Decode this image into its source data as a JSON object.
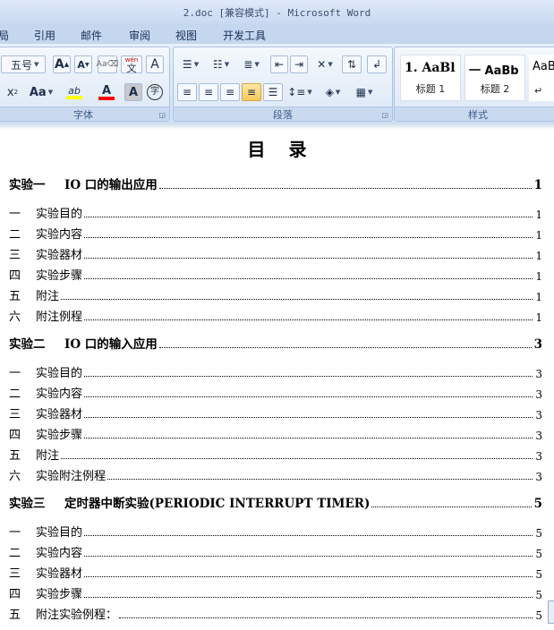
{
  "window": {
    "title": "2.doc [兼容模式] - Microsoft Word"
  },
  "tabs": [
    "局",
    "引用",
    "邮件",
    "审阅",
    "视图",
    "开发工具"
  ],
  "ribbon": {
    "font_size": "五号",
    "grow_font": "A",
    "shrink_font": "A",
    "wen": "wén",
    "wen_char": "文",
    "char_border": "A",
    "subscript": "x",
    "change_case": "Aa",
    "highlight": "ab",
    "font_color_letter": "A",
    "char_shade": "A",
    "enclose": "字",
    "font_group_label": "字体",
    "para_group_label": "段落",
    "styles_group_label": "样式",
    "styles": [
      {
        "sample": "1. AaBl",
        "name": "标题 1"
      },
      {
        "sample": "一 AaBb",
        "name": "标题 2"
      },
      {
        "sample": "AaB",
        "name": "↵"
      }
    ],
    "colors": {
      "highlight": "#ffff00",
      "font_color": "#ff0000"
    }
  },
  "document": {
    "title": "目录",
    "entries": [
      {
        "num": "实验一",
        "text": "IO 口的输出应用",
        "page": "1",
        "level": "chap"
      },
      {
        "num": "一",
        "text": "实验目的",
        "page": "1",
        "level": "sub"
      },
      {
        "num": "二",
        "text": "实验内容",
        "page": "1",
        "level": "sub"
      },
      {
        "num": "三",
        "text": "实验器材",
        "page": "1",
        "level": "sub"
      },
      {
        "num": "四",
        "text": "实验步骤",
        "page": "1",
        "level": "sub"
      },
      {
        "num": "五",
        "text": "附注",
        "page": "1",
        "level": "sub"
      },
      {
        "num": "六",
        "text": "附注例程",
        "page": "1",
        "level": "sub"
      },
      {
        "num": "实验二",
        "text": "IO 口的输入应用",
        "page": "3",
        "level": "chap"
      },
      {
        "num": "一",
        "text": "实验目的",
        "page": "3",
        "level": "sub"
      },
      {
        "num": "二",
        "text": "实验内容",
        "page": "3",
        "level": "sub"
      },
      {
        "num": "三",
        "text": "实验器材",
        "page": "3",
        "level": "sub"
      },
      {
        "num": "四",
        "text": "实验步骤",
        "page": "3",
        "level": "sub"
      },
      {
        "num": "五",
        "text": "附注",
        "page": "3",
        "level": "sub"
      },
      {
        "num": "六",
        "text": "实验附注例程",
        "page": "3",
        "level": "sub"
      },
      {
        "num": "实验三",
        "text": "定时器中断实验(PERIODIC INTERRUPT TIMER)",
        "page": "5",
        "level": "chap"
      },
      {
        "num": "一",
        "text": "实验目的",
        "page": "5",
        "level": "sub"
      },
      {
        "num": "二",
        "text": "实验内容",
        "page": "5",
        "level": "sub"
      },
      {
        "num": "三",
        "text": "实验器材",
        "page": "5",
        "level": "sub"
      },
      {
        "num": "四",
        "text": "实验步骤",
        "page": "5",
        "level": "sub"
      },
      {
        "num": "五",
        "text": "附注实验例程：",
        "page": "5",
        "level": "sub"
      }
    ]
  }
}
